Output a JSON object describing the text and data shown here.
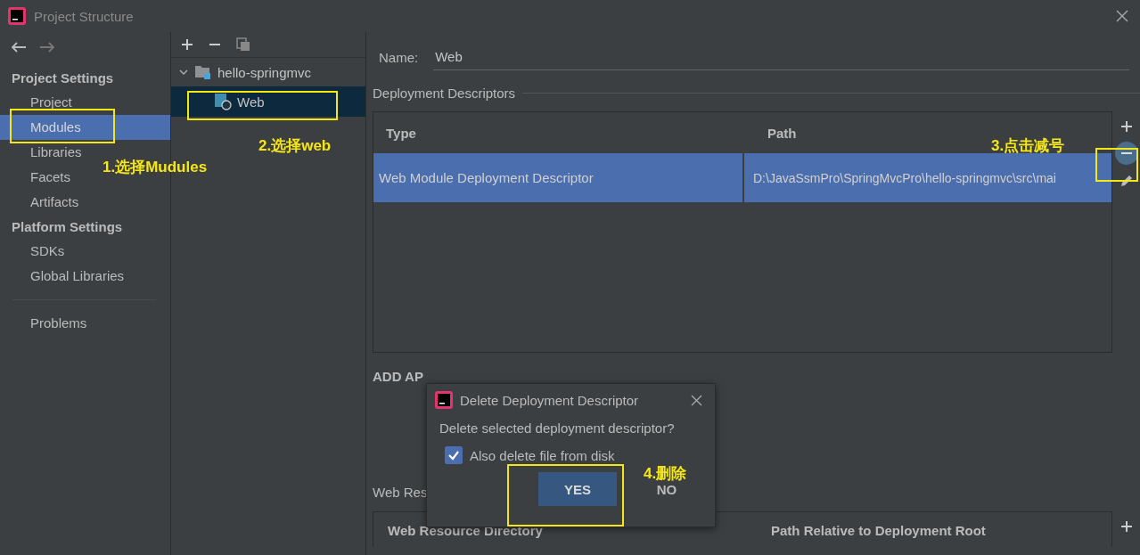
{
  "window": {
    "title": "Project Structure"
  },
  "sidebar": {
    "groups": [
      {
        "heading": "Project Settings",
        "items": [
          {
            "label": "Project",
            "selected": false
          },
          {
            "label": "Modules",
            "selected": true
          },
          {
            "label": "Libraries",
            "selected": false
          },
          {
            "label": "Facets",
            "selected": false
          },
          {
            "label": "Artifacts",
            "selected": false
          }
        ]
      },
      {
        "heading": "Platform Settings",
        "items": [
          {
            "label": "SDKs",
            "selected": false
          },
          {
            "label": "Global Libraries",
            "selected": false
          }
        ]
      }
    ],
    "footer_items": [
      {
        "label": "Problems",
        "selected": false
      }
    ]
  },
  "tree": {
    "nodes": [
      {
        "label": "hello-springmvc",
        "expanded": true,
        "selected": false,
        "children": [
          {
            "label": "Web",
            "selected": true
          }
        ]
      }
    ]
  },
  "detail": {
    "name_label": "Name:",
    "name_value": "Web",
    "section_title": "Deployment Descriptors",
    "table": {
      "columns": [
        "Type",
        "Path"
      ],
      "rows": [
        {
          "cells": [
            "Web Module Deployment Descriptor",
            "D:\\JavaSsmPro\\SpringMvcPro\\hello-springmvc\\src\\mai"
          ],
          "selected": true
        }
      ]
    },
    "partial_label": "ADD AP",
    "section2_title": "Web Res",
    "table2": {
      "columns": [
        "Web Resource Directory",
        "Path Relative to Deployment Root"
      ]
    }
  },
  "dialog": {
    "title": "Delete Deployment Descriptor",
    "message": "Delete selected deployment descriptor?",
    "checkbox": {
      "label": "Also delete file from disk",
      "checked": true
    },
    "buttons": [
      {
        "label": "YES",
        "default": true
      },
      {
        "label": "NO",
        "default": false
      }
    ]
  },
  "annotations": [
    {
      "label": "1.选择Mudules"
    },
    {
      "label": "2.选择web"
    },
    {
      "label": "3.点击减号"
    },
    {
      "label": "4.删除"
    }
  ]
}
